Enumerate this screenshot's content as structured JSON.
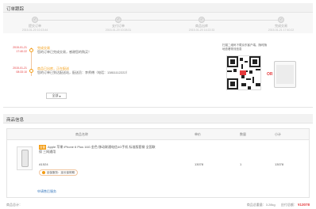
{
  "order_status": {
    "title": "订单跟踪",
    "steps": [
      {
        "label": "提交订单",
        "time": "2015-01-20 10:13:44"
      },
      {
        "label": "支付订单",
        "time": "2015-01-20 10:28:31"
      },
      {
        "label": "商品出库",
        "time": "2015-01-20 14:22:33"
      },
      {
        "label": "完成交易",
        "time": "2015-01-21 17:40:22"
      }
    ]
  },
  "timeline": {
    "items": [
      {
        "date": "2015-01-21",
        "time": "17:40:22",
        "title": "完成交易",
        "desc": "您的订单已完成交易，感谢您的购买！"
      },
      {
        "date": "2015-01-21",
        "time": "08:33:10",
        "title": "商品已出库，正在配送",
        "desc": "您的订单已到达配送站，配送员：李师傅（电话：13811112222）"
      }
    ],
    "collapse_label": "全部"
  },
  "qr": {
    "tip": "扫描二维码下载京东客户端，随时随地查看物流信息",
    "arrow": "OR"
  },
  "goods": {
    "title": "商品信息",
    "headers": {
      "name": "商品名称",
      "price": "单价",
      "qty": "数量",
      "subtotal": "小计"
    },
    "item": {
      "tag": "自营",
      "name": "Apple 苹果 iPhone 6 Plus 16G 金色 移动联通电信4G手机 标准版套餐 全国联保 三网通用",
      "attr": "A1524",
      "service": "延保服务：延长保修期",
      "price": "13078",
      "qty": "1",
      "subtotal": "13078"
    },
    "service_link": "申请售后服务"
  },
  "footer": {
    "left": "商品总计：",
    "weight": "商品总重量：3.28kg",
    "total_label": "应付总额：",
    "total": "¥13078"
  },
  "colors": {
    "accent": "#e4393c",
    "orange": "#f39c12",
    "link": "#3b7bbf"
  }
}
